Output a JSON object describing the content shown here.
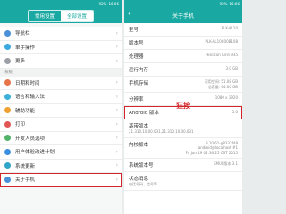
{
  "status": {
    "time": "16:06",
    "battery": "92%"
  },
  "left": {
    "tabs": [
      "常用设置",
      "全部设置"
    ],
    "group1": [
      {
        "label": "导航栏",
        "icon": "navigation-icon",
        "color": "#4a90d9"
      },
      {
        "label": "单手操作",
        "icon": "one-hand-icon",
        "color": "#3ba9e0"
      },
      {
        "label": "更多",
        "icon": "more-icon",
        "color": "#9aa0a6"
      }
    ],
    "section_label": "系统",
    "group2": [
      {
        "label": "日期和时间",
        "icon": "clock-icon",
        "color": "#e8744a"
      },
      {
        "label": "语言和输入法",
        "icon": "language-icon",
        "color": "#3bb0d8"
      },
      {
        "label": "辅助功能",
        "icon": "accessibility-icon",
        "color": "#f0a030"
      },
      {
        "label": "打印",
        "icon": "printer-icon",
        "color": "#e25555"
      },
      {
        "label": "开发人员选项",
        "icon": "developer-icon",
        "color": "#52b36a"
      },
      {
        "label": "用户体验改进计划",
        "icon": "feedback-icon",
        "color": "#3a8ee0"
      },
      {
        "label": "系统更新",
        "icon": "update-icon",
        "color": "#2fa5c8"
      },
      {
        "label": "关于手机",
        "icon": "about-phone-icon",
        "color": "#4a90d9"
      }
    ]
  },
  "right": {
    "title": "关于手机",
    "rows": [
      {
        "key": "型号",
        "value": "PLK-AL10"
      },
      {
        "key": "版本号",
        "value": "PLK-AL10C00B108"
      },
      {
        "key": "处理器",
        "value": "Hisilicon Kirin 935"
      },
      {
        "key": "运行内存",
        "value": "3.0 GB"
      },
      {
        "key": "手机存储",
        "value": "可用空间: 51.08 GB\n总容量: 64.00 GB"
      },
      {
        "key": "分辨率",
        "value": "1080 x 1920"
      },
      {
        "key": "Android 版本",
        "value": "5.0"
      },
      {
        "key": "基带版本",
        "value": "21.310.10.00.031,21.310.10.00.031"
      },
      {
        "key": "内核版本",
        "value": "3.10.61-g8332f48\nandroid@localhost #1\nFri Jun 19 02:36:25 CST 2015"
      },
      {
        "key": "系统版本号",
        "value": "EMUI 版本 3.1"
      },
      {
        "key": "状态消息",
        "value": "电话号码、信号等"
      }
    ],
    "annotation": "狂按"
  },
  "colors": {
    "accent": "#1aa9a2",
    "highlight": "#d3262b"
  }
}
